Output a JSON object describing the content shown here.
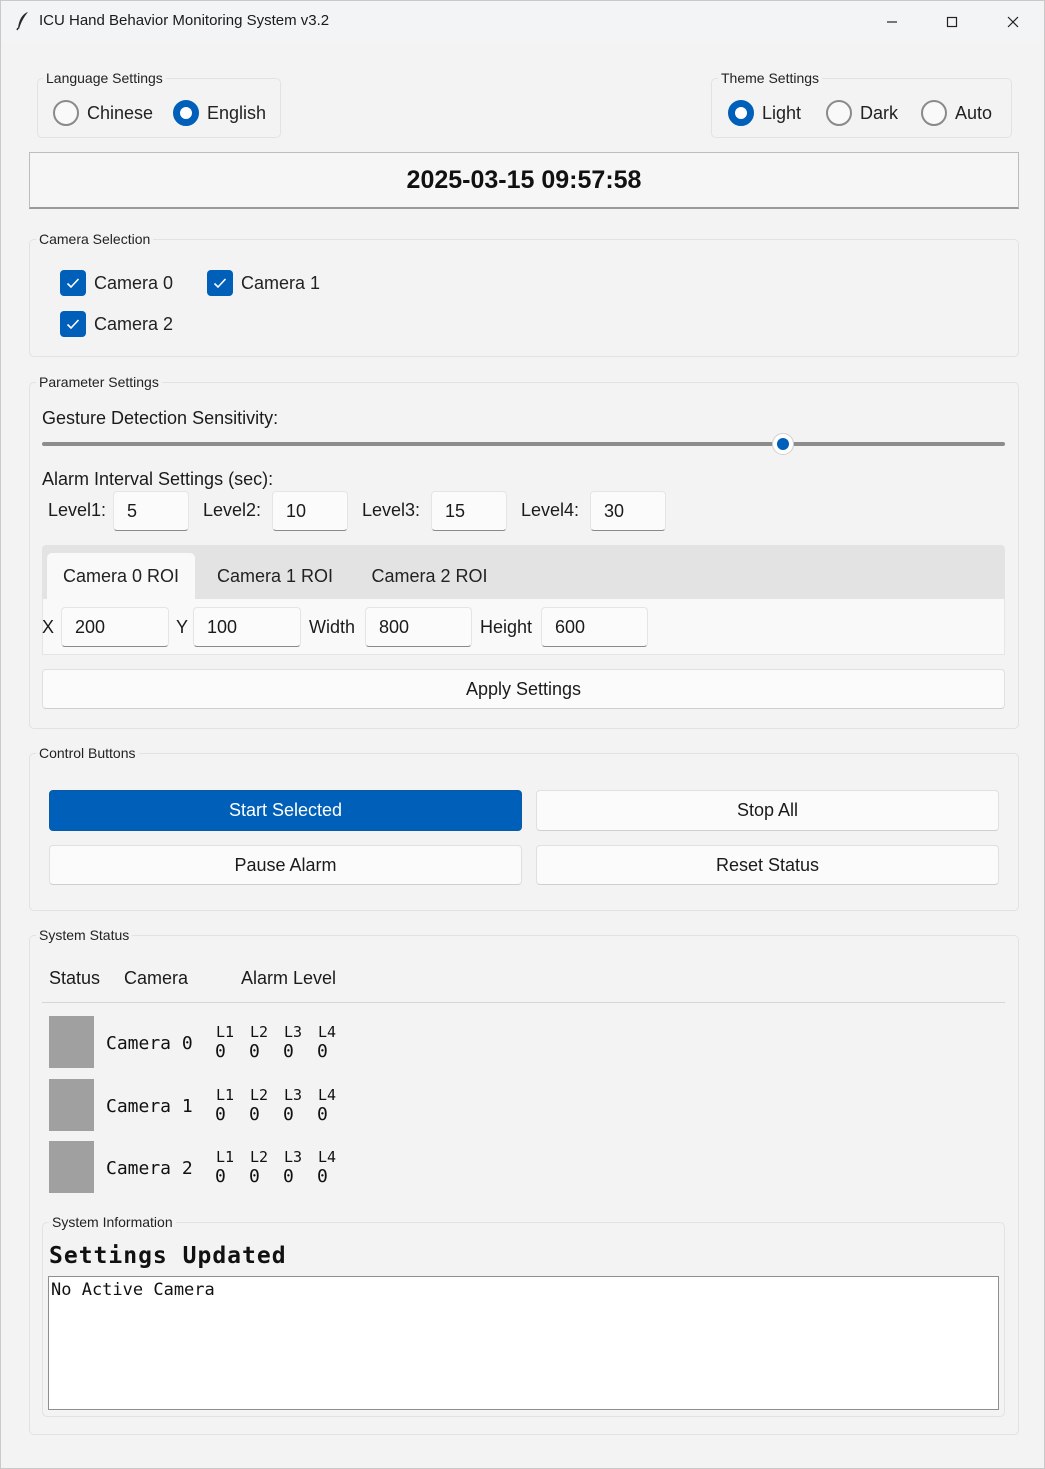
{
  "window": {
    "title": "ICU Hand Behavior Monitoring System v3.2",
    "controls": [
      "minimize",
      "maximize",
      "close"
    ]
  },
  "language": {
    "group_title": "Language Settings",
    "options": [
      {
        "label": "Chinese",
        "selected": false
      },
      {
        "label": "English",
        "selected": true
      }
    ]
  },
  "theme": {
    "group_title": "Theme Settings",
    "options": [
      {
        "label": "Light",
        "selected": true
      },
      {
        "label": "Dark",
        "selected": false
      },
      {
        "label": "Auto",
        "selected": false
      }
    ]
  },
  "datetime": "2025-03-15 09:57:58",
  "camera_selection": {
    "group_title": "Camera Selection",
    "cameras": [
      {
        "label": "Camera 0",
        "checked": true
      },
      {
        "label": "Camera 1",
        "checked": true
      },
      {
        "label": "Camera 2",
        "checked": true
      }
    ]
  },
  "parameters": {
    "group_title": "Parameter Settings",
    "sensitivity_label": "Gesture Detection Sensitivity:",
    "sensitivity_value_fraction": 0.769,
    "alarm_interval_label": "Alarm Interval Settings (sec):",
    "levels": [
      {
        "label": "Level1:",
        "value": "5"
      },
      {
        "label": "Level2:",
        "value": "10"
      },
      {
        "label": "Level3:",
        "value": "15"
      },
      {
        "label": "Level4:",
        "value": "30"
      }
    ],
    "roi_tabs": [
      "Camera 0 ROI",
      "Camera 1 ROI",
      "Camera 2 ROI"
    ],
    "active_roi_tab": 0,
    "roi": {
      "x_label": "X",
      "x": "200",
      "y_label": "Y",
      "y": "100",
      "width_label": "Width",
      "width": "800",
      "height_label": "Height",
      "height": "600"
    },
    "apply_label": "Apply Settings"
  },
  "controls": {
    "group_title": "Control Buttons",
    "start_label": "Start Selected",
    "stop_label": "Stop All",
    "pause_label": "Pause Alarm",
    "reset_label": "Reset Status"
  },
  "system_status": {
    "group_title": "System Status",
    "headers": {
      "status": "Status",
      "camera": "Camera",
      "alarm": "Alarm Level"
    },
    "level_labels": [
      "L1",
      "L2",
      "L3",
      "L4"
    ],
    "rows": [
      {
        "camera": "Camera 0",
        "levels": [
          "0",
          "0",
          "0",
          "0"
        ],
        "status_color": "#a0a0a0"
      },
      {
        "camera": "Camera 1",
        "levels": [
          "0",
          "0",
          "0",
          "0"
        ],
        "status_color": "#a0a0a0"
      },
      {
        "camera": "Camera 2",
        "levels": [
          "0",
          "0",
          "0",
          "0"
        ],
        "status_color": "#a0a0a0"
      }
    ]
  },
  "system_info": {
    "group_title": "System Information",
    "title": "Settings Updated",
    "message": "No Active Camera"
  },
  "colors": {
    "accent": "#005fb8",
    "status_idle": "#a0a0a0"
  }
}
